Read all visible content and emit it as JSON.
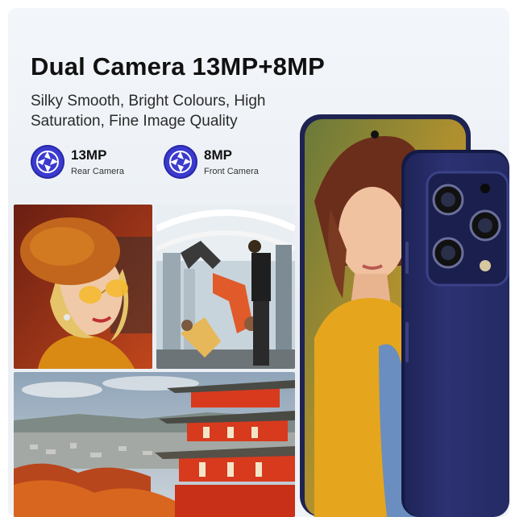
{
  "headline": "Dual Camera 13MP+8MP",
  "subtitle": "Silky Smooth, Bright Colours, High Saturation, Fine Image Quality",
  "features": [
    {
      "megapixels": "13MP",
      "label": "Rear Camera",
      "icon": "camera-aperture-icon"
    },
    {
      "megapixels": "8MP",
      "label": "Front Camera",
      "icon": "camera-aperture-icon"
    }
  ],
  "colors": {
    "accent": "#3b3bcf",
    "phone_body": "#2a2f66",
    "background": "#eef2f6"
  }
}
